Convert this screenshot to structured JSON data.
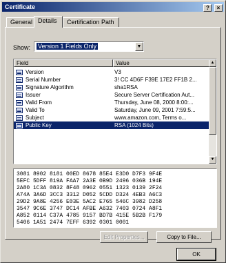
{
  "window": {
    "title": "Certificate"
  },
  "titlebar_buttons": {
    "help": "?",
    "close": "×"
  },
  "tabs": [
    {
      "label": "General"
    },
    {
      "label": "Details"
    },
    {
      "label": "Certification Path"
    }
  ],
  "show": {
    "label": "Show:",
    "value": "Version 1 Fields Only"
  },
  "fields_table": {
    "headers": {
      "field": "Field",
      "value": "Value"
    },
    "rows": [
      {
        "field": "Version",
        "value": "V3"
      },
      {
        "field": "Serial Number",
        "value": "3! CC 4D6F F39E 17E2 FF1B 2..."
      },
      {
        "field": "Signature Algorithm",
        "value": "sha1RSA"
      },
      {
        "field": "Issuer",
        "value": "Secure Server Certification Aut..."
      },
      {
        "field": "Valid From",
        "value": "Thursday, June 08, 2000 8:00:..."
      },
      {
        "field": "Valid To",
        "value": "Saturday, June 09, 2001 7:59:5..."
      },
      {
        "field": "Subject",
        "value": "www.amazon.com, Terms o..."
      },
      {
        "field": "Public Key",
        "value": "RSA (1024 Bits)"
      }
    ],
    "selected_index": 7
  },
  "hex_dump": [
    "3081 8902 8181 00ED 8678 85E4 E3D0 D7F3 9F4E",
    "5EFC 5DFF 819A FAA7 2A3E 0B9D 2496 036B 194E",
    "2A80 1C3A 0832 8F48 0962 0551 1323 0139 2F24",
    "A74A 3A6D 3CC3 3312 D052 5CDD D324 4EB3 A6C3",
    "29D2 9A8E 4256 E03E 5AC2 E765 546C 3982 D258",
    "3547 9C6E 3747 DC14 AFBE A632 7403 0724 A8F1",
    "A852 0114 C37A 4785 9157 BD7B 415E 5B2B F179",
    "5406 1A51 2474 7EFF 6392 0301 0001"
  ],
  "buttons": {
    "edit_properties": "Edit Properties...",
    "copy_to_file": "Copy to File...",
    "ok": "OK"
  }
}
